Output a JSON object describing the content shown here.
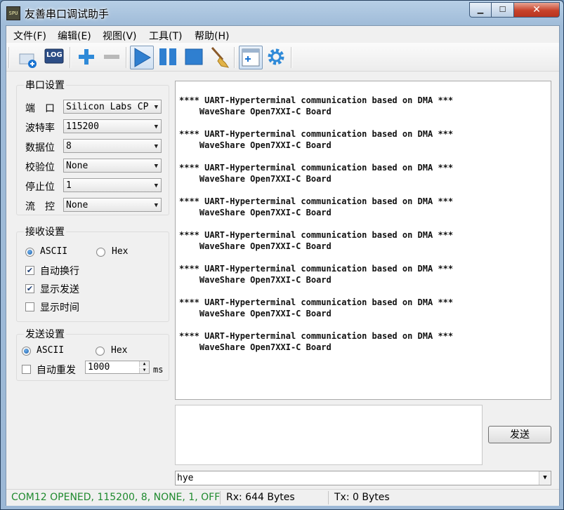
{
  "window": {
    "title": "友善串口调试助手",
    "app_icon": "SPU",
    "controls": {
      "minimize": "▁",
      "maximize": "☐",
      "close": "✕"
    }
  },
  "menu": [
    "文件(F)",
    "编辑(E)",
    "视图(V)",
    "工具(T)",
    "帮助(H)"
  ],
  "toolbar": {
    "log_label": "LOG",
    "icons": [
      "new-session-icon",
      "log-icon",
      "add-icon",
      "remove-icon",
      "play-icon",
      "pause-icon",
      "stop-icon",
      "broom-icon",
      "add-window-icon",
      "gear-icon"
    ]
  },
  "serial_settings": {
    "title": "串口设置",
    "rows": [
      {
        "label": "端　口",
        "value": "Silicon Labs CP"
      },
      {
        "label": "波特率",
        "value": "115200"
      },
      {
        "label": "数据位",
        "value": "8"
      },
      {
        "label": "校验位",
        "value": "None"
      },
      {
        "label": "停止位",
        "value": "1"
      },
      {
        "label": "流　控",
        "value": "None"
      }
    ]
  },
  "receive_settings": {
    "title": "接收设置",
    "ascii": "ASCII",
    "hex": "Hex",
    "mode": "ASCII",
    "options": [
      {
        "label": "自动换行",
        "checked": true
      },
      {
        "label": "显示发送",
        "checked": true
      },
      {
        "label": "显示时间",
        "checked": false
      }
    ]
  },
  "send_settings": {
    "title": "发送设置",
    "ascii": "ASCII",
    "hex": "Hex",
    "mode": "ASCII",
    "auto_resend_label": "自动重发",
    "auto_resend_checked": false,
    "interval_value": "1000",
    "interval_unit": "ms"
  },
  "receive_area": {
    "lines": [
      "**** UART-Hyperterminal communication based on DMA ***",
      "    WaveShare Open7XXI-C Board",
      "**** UART-Hyperterminal communication based on DMA ***",
      "    WaveShare Open7XXI-C Board",
      "**** UART-Hyperterminal communication based on DMA ***",
      "    WaveShare Open7XXI-C Board",
      "**** UART-Hyperterminal communication based on DMA ***",
      "    WaveShare Open7XXI-C Board",
      "**** UART-Hyperterminal communication based on DMA ***",
      "    WaveShare Open7XXI-C Board",
      "**** UART-Hyperterminal communication based on DMA ***",
      "    WaveShare Open7XXI-C Board",
      "**** UART-Hyperterminal communication based on DMA ***",
      "    WaveShare Open7XXI-C Board",
      "**** UART-Hyperterminal communication based on DMA ***",
      "    WaveShare Open7XXI-C Board"
    ]
  },
  "send_area": {
    "text": "",
    "send_button": "发送",
    "history_value": "hye"
  },
  "status": {
    "port_status": "COM12 OPENED, 115200, 8, NONE, 1, OFF",
    "rx": "Rx: 644 Bytes",
    "tx": "Tx: 0 Bytes",
    "port_status_color": "#1f8a2e"
  }
}
